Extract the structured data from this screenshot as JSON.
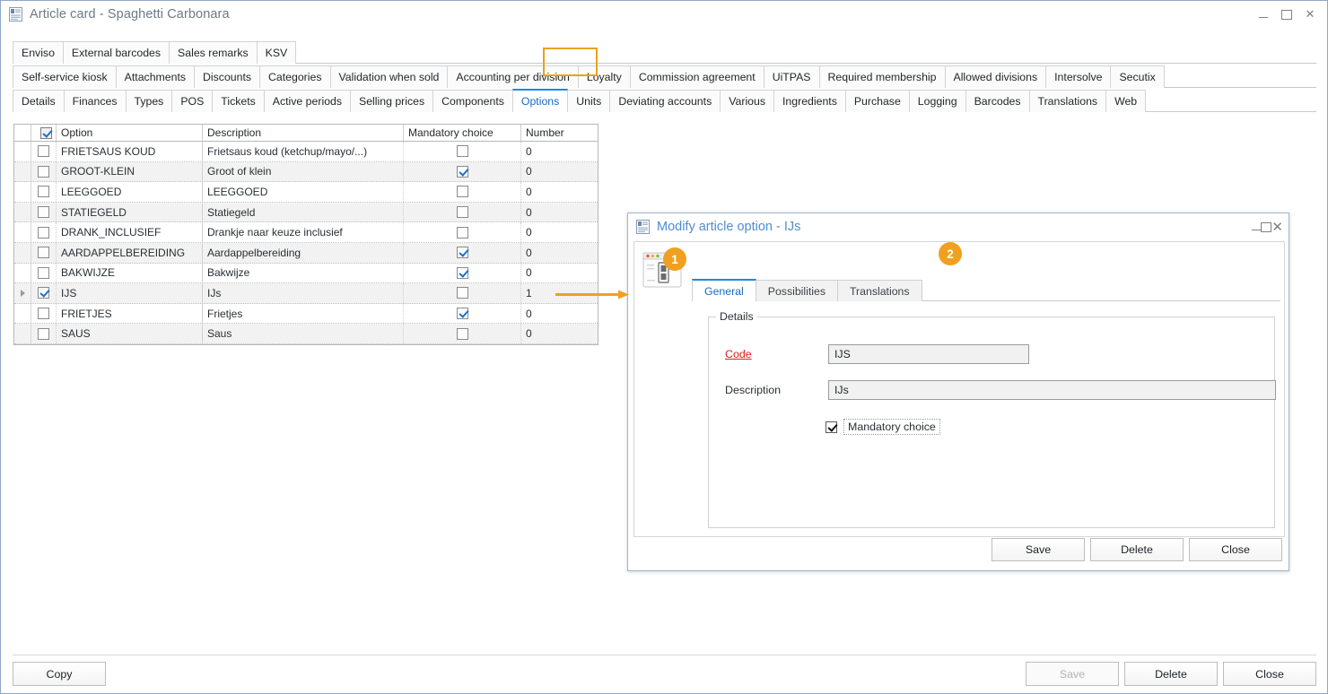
{
  "window": {
    "title": "Article card - Spaghetti Carbonara",
    "icon": "article-card-icon",
    "controls": {
      "minimize": "minimize-icon",
      "maximize": "maximize-icon",
      "close": "close-icon"
    }
  },
  "tabs": {
    "row1": [
      {
        "label": "Enviso",
        "active": false
      },
      {
        "label": "External barcodes",
        "active": false
      },
      {
        "label": "Sales remarks",
        "active": false
      },
      {
        "label": "KSV",
        "active": false
      }
    ],
    "row2": [
      {
        "label": "Self-service kiosk",
        "active": false
      },
      {
        "label": "Attachments",
        "active": false
      },
      {
        "label": "Discounts",
        "active": false
      },
      {
        "label": "Categories",
        "active": false
      },
      {
        "label": "Validation when sold",
        "active": false
      },
      {
        "label": "Accounting per division",
        "active": false
      },
      {
        "label": "Loyalty",
        "active": false
      },
      {
        "label": "Commission agreement",
        "active": false
      },
      {
        "label": "UiTPAS",
        "active": false
      },
      {
        "label": "Required membership",
        "active": false
      },
      {
        "label": "Allowed divisions",
        "active": false
      },
      {
        "label": "Intersolve",
        "active": false
      },
      {
        "label": "Secutix",
        "active": false
      }
    ],
    "row3": [
      {
        "label": "Details",
        "active": false
      },
      {
        "label": "Finances",
        "active": false
      },
      {
        "label": "Types",
        "active": false
      },
      {
        "label": "POS",
        "active": false
      },
      {
        "label": "Tickets",
        "active": false
      },
      {
        "label": "Active periods",
        "active": false
      },
      {
        "label": "Selling prices",
        "active": false
      },
      {
        "label": "Components",
        "active": false
      },
      {
        "label": "Options",
        "active": true
      },
      {
        "label": "Units",
        "active": false
      },
      {
        "label": "Deviating accounts",
        "active": false
      },
      {
        "label": "Various",
        "active": false
      },
      {
        "label": "Ingredients",
        "active": false
      },
      {
        "label": "Purchase",
        "active": false
      },
      {
        "label": "Logging",
        "active": false
      },
      {
        "label": "Barcodes",
        "active": false
      },
      {
        "label": "Translations",
        "active": false
      },
      {
        "label": "Web",
        "active": false
      }
    ]
  },
  "grid": {
    "header": {
      "select_all_checked": true,
      "columns": [
        "Option",
        "Description",
        "Mandatory choice",
        "Number"
      ]
    },
    "rows": [
      {
        "selected": false,
        "current": false,
        "option": "FRIETSAUS KOUD",
        "description": "Frietsaus koud (ketchup/mayo/...)",
        "mandatory": false,
        "number": "0"
      },
      {
        "selected": false,
        "current": false,
        "option": "GROOT-KLEIN",
        "description": "Groot of klein",
        "mandatory": true,
        "number": "0"
      },
      {
        "selected": false,
        "current": false,
        "option": "LEEGGOED",
        "description": "LEEGGOED",
        "mandatory": false,
        "number": "0"
      },
      {
        "selected": false,
        "current": false,
        "option": "STATIEGELD",
        "description": "Statiegeld",
        "mandatory": false,
        "number": "0"
      },
      {
        "selected": false,
        "current": false,
        "option": "DRANK_INCLUSIEF",
        "description": "Drankje naar keuze inclusief",
        "mandatory": false,
        "number": "0"
      },
      {
        "selected": false,
        "current": false,
        "option": "AARDAPPELBEREIDING",
        "description": "Aardappelbereiding",
        "mandatory": true,
        "number": "0"
      },
      {
        "selected": false,
        "current": false,
        "option": "BAKWIJZE",
        "description": "Bakwijze",
        "mandatory": true,
        "number": "0"
      },
      {
        "selected": true,
        "current": true,
        "option": "IJS",
        "description": "IJs",
        "mandatory": false,
        "number": "1"
      },
      {
        "selected": false,
        "current": false,
        "option": "FRIETJES",
        "description": "Frietjes",
        "mandatory": true,
        "number": "0"
      },
      {
        "selected": false,
        "current": false,
        "option": "SAUS",
        "description": "Saus",
        "mandatory": false,
        "number": "0"
      }
    ]
  },
  "footer": {
    "copy_label": "Copy",
    "save_label": "Save",
    "save_disabled": true,
    "delete_label": "Delete",
    "close_label": "Close"
  },
  "modal": {
    "title": "Modify article option - IJs",
    "icon": "article-option-icon",
    "controls": {
      "minimize": "minimize-icon",
      "maximize": "maximize-icon",
      "close": "close-icon"
    },
    "side_icon": "dialog-preview-icon",
    "tabs": [
      {
        "label": "General",
        "active": true
      },
      {
        "label": "Possibilities",
        "active": false
      },
      {
        "label": "Translations",
        "active": false
      }
    ],
    "details": {
      "legend": "Details",
      "code_label": "Code",
      "code_value": "IJS",
      "description_label": "Description",
      "description_value": "IJs",
      "mandatory_label": "Mandatory choice",
      "mandatory_checked": true
    },
    "buttons": {
      "save_label": "Save",
      "delete_label": "Delete",
      "close_label": "Close"
    }
  },
  "annotations": {
    "badges": [
      {
        "id": "1",
        "target": "modal-tab-general"
      },
      {
        "id": "2",
        "target": "modal-tab-translations"
      }
    ],
    "highlight_color": "#e8a317",
    "arrow": {
      "from": "grid-row-ijs",
      "to": "modal"
    }
  }
}
